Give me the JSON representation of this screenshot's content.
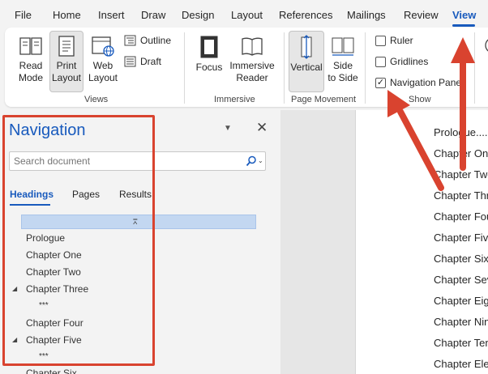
{
  "menu": {
    "tabs": [
      "File",
      "Home",
      "Insert",
      "Draw",
      "Design",
      "Layout",
      "References",
      "Mailings",
      "Review",
      "View"
    ],
    "active_tab": "View"
  },
  "ribbon": {
    "views": {
      "read_mode": "Read\nMode",
      "print_layout": "Print\nLayout",
      "web_layout": "Web\nLayout",
      "outline": "Outline",
      "draft": "Draft",
      "label": "Views"
    },
    "immersive": {
      "focus": "Focus",
      "immersive_reader": "Immersive\nReader",
      "label": "Immersive"
    },
    "page_movement": {
      "vertical": "Vertical",
      "side_to_side": "Side\nto Side",
      "label": "Page Movement"
    },
    "show": {
      "ruler": "Ruler",
      "ruler_checked": false,
      "gridlines": "Gridlines",
      "gridlines_checked": false,
      "navigation_pane": "Navigation Pane",
      "navigation_pane_checked": true,
      "label": "Show"
    }
  },
  "navigation": {
    "title": "Navigation",
    "search_placeholder": "Search document",
    "tabs": [
      "Headings",
      "Pages",
      "Results"
    ],
    "active_tab": "Headings",
    "headings": [
      {
        "label": "Prologue",
        "collapsible": false
      },
      {
        "label": "Chapter One",
        "collapsible": false
      },
      {
        "label": "Chapter Two",
        "collapsible": false
      },
      {
        "label": "Chapter Three",
        "collapsible": true
      },
      {
        "label": "***",
        "sub": true
      },
      {
        "label": "Chapter Four",
        "collapsible": false
      },
      {
        "label": "Chapter Five",
        "collapsible": true
      },
      {
        "label": "***",
        "sub": true
      },
      {
        "label": "Chapter Six",
        "collapsible": false
      }
    ]
  },
  "document": {
    "toc": [
      "Prologue.....",
      "Chapter One",
      "Chapter Two",
      "Chapter Three",
      "Chapter Four",
      "Chapter Five",
      "Chapter Six",
      "Chapter Seven",
      "Chapter Eight",
      "Chapter Nine",
      "Chapter Ten",
      "Chapter Eleven"
    ]
  },
  "colors": {
    "accent": "#185abd",
    "annotation": "#d9432f",
    "heading_bar": "#c3d7f1"
  }
}
